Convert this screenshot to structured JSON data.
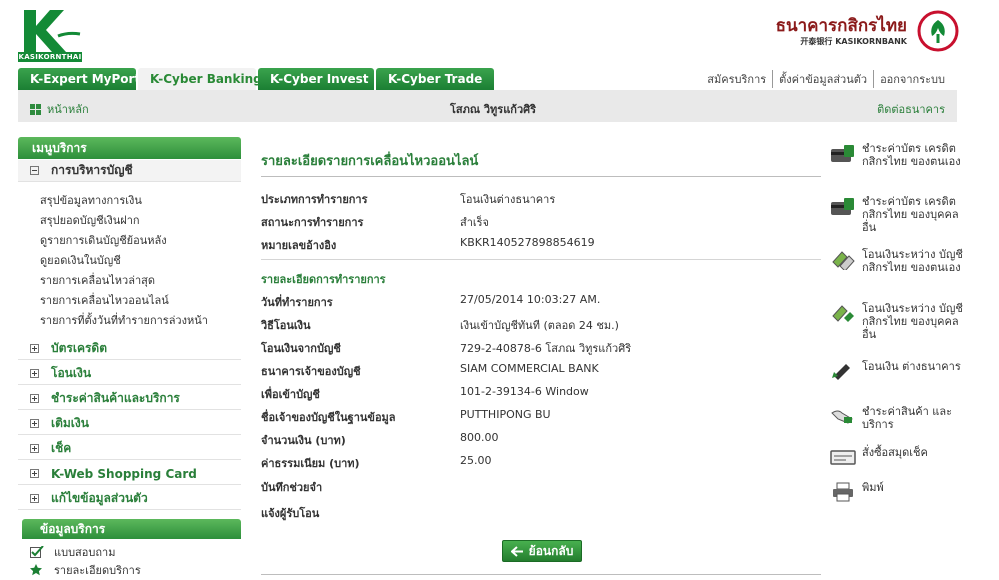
{
  "header": {
    "logo_text": "KASIKORNTHAI",
    "bank_name_th": "ธนาคารกสิกรไทย",
    "bank_name_en": "开泰银行 KASIKORNBANK"
  },
  "tabs": [
    {
      "label": "K-Expert MyPort"
    },
    {
      "label": "K-Cyber Banking"
    },
    {
      "label": "K-Cyber Invest"
    },
    {
      "label": "K-Cyber Trade"
    }
  ],
  "top_links": [
    "สมัครบริการ",
    "ตั้งค่าข้อมูลส่วนตัว",
    "ออกจากระบบ"
  ],
  "subbar": {
    "home": "หน้าหลัก",
    "user_name": "โสภณ วิทูรแก้วศิริ",
    "contact": "ติดต่อธนาคาร"
  },
  "sidebar": {
    "menu_title": "เมนูบริการ",
    "account_group": "การบริหารบัญชี",
    "account_items": [
      "สรุปข้อมูลทางการเงิน",
      "สรุปยอดบัญชีเงินฝาก",
      "ดูรายการเดินบัญชีย้อนหลัง",
      "ดูยอดเงินในบัญชี",
      "รายการเคลื่อนไหวล่าสุด",
      "รายการเคลื่อนไหวออนไลน์",
      "รายการที่ตั้งวันที่ทำรายการล่วงหน้า"
    ],
    "groups": [
      "บัตรเครดิต",
      "โอนเงิน",
      "ชำระค่าสินค้าและบริการ",
      "เติมเงิน",
      "เช็ค",
      "K-Web Shopping Card",
      "แก้ไขข้อมูลส่วนตัว"
    ],
    "info_title": "ข้อมูลบริการ",
    "info_items": [
      "แบบสอบถาม",
      "รายละเอียดบริการ"
    ]
  },
  "main": {
    "title": "รายละเอียดรายการเคลื่อนไหวออนไลน์",
    "top_rows": [
      {
        "label": "ประเภทการทำรายการ",
        "value": "โอนเงินต่างธนาคาร"
      },
      {
        "label": "สถานะการทำรายการ",
        "value": "สำเร็จ"
      },
      {
        "label": "หมายเลขอ้างอิง",
        "value": "KBKR140527898854619"
      }
    ],
    "section_title": "รายละเอียดการทำรายการ",
    "detail_rows": [
      {
        "label": "วันที่ทำรายการ",
        "value": "27/05/2014 10:03:27 AM."
      },
      {
        "label": "วิธีโอนเงิน",
        "value": "เงินเข้าบัญชีทันที (ตลอด 24 ชม.)"
      },
      {
        "label": "โอนเงินจากบัญชี",
        "value": "729-2-40878-6 โสภณ วิทูรแก้วศิริ"
      },
      {
        "label": "ธนาคารเจ้าของบัญชี",
        "value": "SIAM COMMERCIAL BANK"
      },
      {
        "label": "เพื่อเข้าบัญชี",
        "value": "101-2-39134-6 Window"
      },
      {
        "label": "ชื่อเจ้าของบัญชีในฐานข้อมูล",
        "value": "PUTTHIPONG BU"
      },
      {
        "label": "จำนวนเงิน (บาท)",
        "value": "800.00"
      },
      {
        "label": "ค่าธรรมเนียม (บาท)",
        "value": "25.00"
      },
      {
        "label": "บันทึกช่วยจำ",
        "value": ""
      },
      {
        "label": "แจ้งผู้รับโอน",
        "value": ""
      }
    ],
    "back_label": "ย้อนกลับ"
  },
  "quick_links": [
    {
      "label": "ชำระค่าบัตร เครดิตกสิกรไทย ของตนเอง",
      "icon": "credit-card-payment-icon"
    },
    {
      "label": "ชำระค่าบัตร เครดิตกสิกรไทย ของบุคคลอื่น",
      "icon": "credit-card-payment-other-icon"
    },
    {
      "label": "โอนเงินระหว่าง บัญชีกสิกรไทย ของตนเอง",
      "icon": "transfer-own-icon"
    },
    {
      "label": "โอนเงินระหว่าง บัญชีกสิกรไทย ของบุคคลอื่น",
      "icon": "transfer-other-icon"
    },
    {
      "label": "โอนเงิน ต่างธนาคาร",
      "icon": "interbank-transfer-icon"
    },
    {
      "label": "ชำระค่าสินค้า และบริการ",
      "icon": "bill-payment-icon"
    },
    {
      "label": "สั่งซื้อสมุดเช็ค",
      "icon": "cheque-book-icon"
    },
    {
      "label": "พิมพ์",
      "icon": "print-icon"
    }
  ],
  "colors": {
    "brand_green": "#2a8a36",
    "tab_green": "#1b7f33",
    "bank_red": "#8b1a1a"
  }
}
